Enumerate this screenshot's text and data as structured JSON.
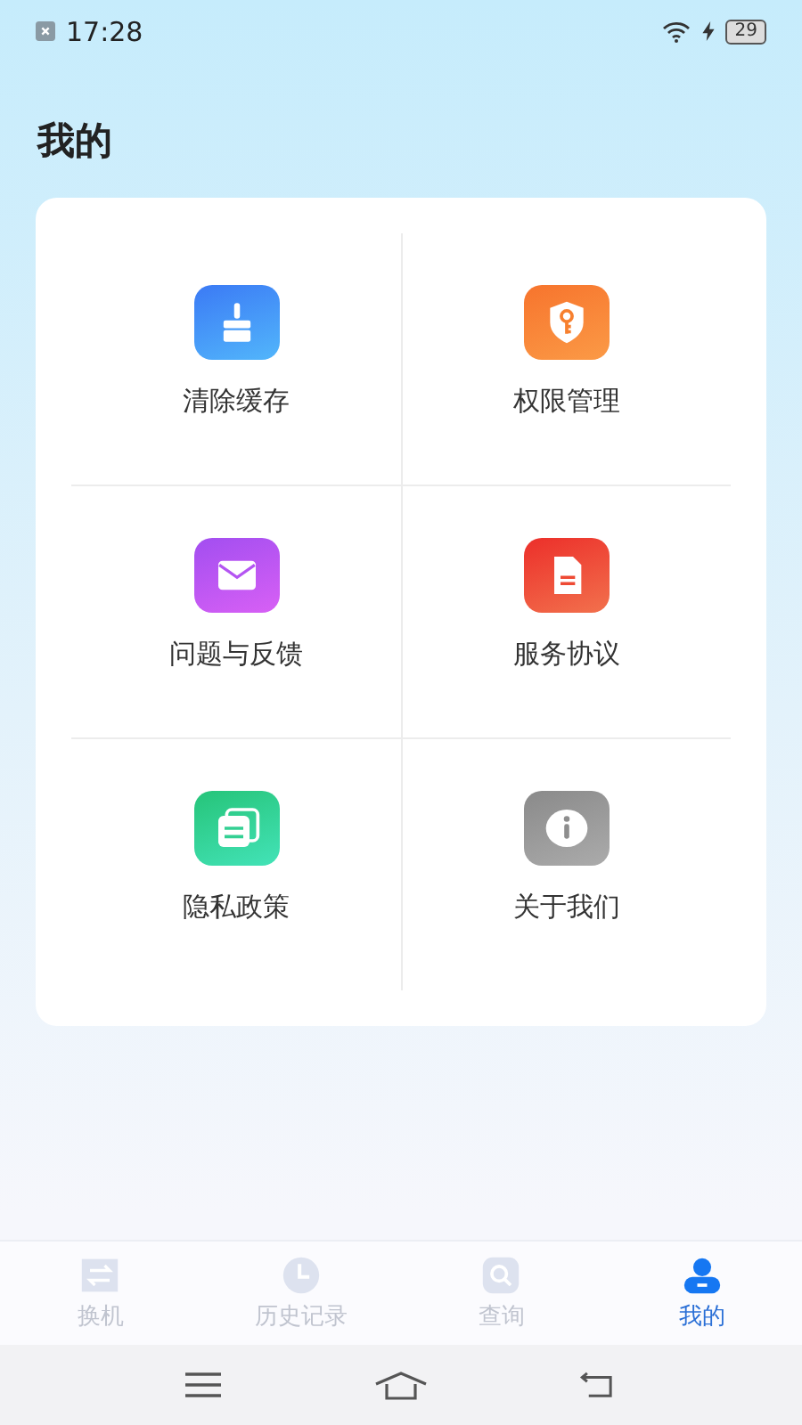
{
  "status_bar": {
    "time": "17:28",
    "battery": "29"
  },
  "title": "我的",
  "menu": [
    {
      "kind": "brush",
      "label": "清除缓存"
    },
    {
      "kind": "shield",
      "label": "权限管理"
    },
    {
      "kind": "mail",
      "label": "问题与反馈"
    },
    {
      "kind": "document",
      "label": "服务协议"
    },
    {
      "kind": "cards",
      "label": "隐私政策"
    },
    {
      "kind": "info",
      "label": "关于我们"
    }
  ],
  "tabs": [
    {
      "kind": "swap",
      "label": "换机",
      "selected": false
    },
    {
      "kind": "clock",
      "label": "历史记录",
      "selected": false
    },
    {
      "kind": "search",
      "label": "查询",
      "selected": false
    },
    {
      "kind": "person",
      "label": "我的",
      "selected": true
    }
  ]
}
